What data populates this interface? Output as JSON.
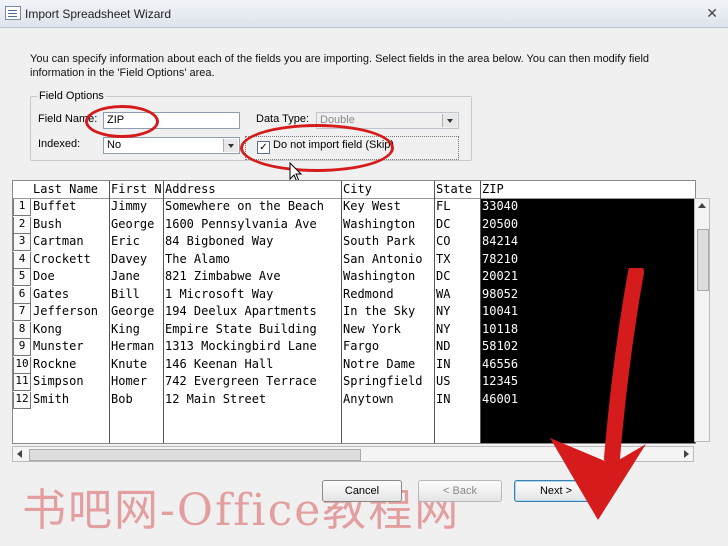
{
  "window": {
    "title": "Import Spreadsheet Wizard",
    "close_glyph": "✕"
  },
  "instructions": "You can specify information about each of the fields you are importing. Select fields in the area below. You can then modify field information in the 'Field Options' area.",
  "field_options": {
    "legend": "Field Options",
    "field_name_label": "Field Name:",
    "field_name_value": "ZIP",
    "data_type_label": "Data Type:",
    "data_type_value": "Double",
    "indexed_label": "Indexed:",
    "indexed_value": "No",
    "skip_label": "Do not import field (Skip)",
    "skip_checked": "✓"
  },
  "grid": {
    "headers": [
      "Last Name",
      "First N",
      "Address",
      "City",
      "State",
      "ZIP"
    ],
    "rows": [
      {
        "n": "1",
        "c": [
          "Buffet",
          "Jimmy",
          "Somewhere on the Beach",
          "Key West",
          "FL",
          "33040"
        ]
      },
      {
        "n": "2",
        "c": [
          "Bush",
          "George",
          "1600 Pennsylvania Ave",
          "Washington",
          "DC",
          "20500"
        ]
      },
      {
        "n": "3",
        "c": [
          "Cartman",
          "Eric",
          "84 Bigboned Way",
          "South Park",
          "CO",
          "84214"
        ]
      },
      {
        "n": "4",
        "c": [
          "Crockett",
          "Davey",
          "The Alamo",
          "San Antonio",
          "TX",
          "78210"
        ]
      },
      {
        "n": "5",
        "c": [
          "Doe",
          "Jane",
          "821 Zimbabwe Ave",
          "Washington",
          "DC",
          "20021"
        ]
      },
      {
        "n": "6",
        "c": [
          "Gates",
          "Bill",
          "1 Microsoft Way",
          "Redmond",
          "WA",
          "98052"
        ]
      },
      {
        "n": "7",
        "c": [
          "Jefferson",
          "George",
          "194 Deelux Apartments",
          "In the Sky",
          "NY",
          "10041"
        ]
      },
      {
        "n": "8",
        "c": [
          "Kong",
          "King",
          "Empire State Building",
          "New York",
          "NY",
          "10118"
        ]
      },
      {
        "n": "9",
        "c": [
          "Munster",
          "Herman",
          "1313 Mockingbird Lane",
          "Fargo",
          "ND",
          "58102"
        ]
      },
      {
        "n": "10",
        "c": [
          "Rockne",
          "Knute",
          "146 Keenan Hall",
          "Notre Dame",
          "IN",
          "46556"
        ]
      },
      {
        "n": "11",
        "c": [
          "Simpson",
          "Homer",
          "742 Evergreen Terrace",
          "Springfield",
          "US",
          "12345"
        ]
      },
      {
        "n": "12",
        "c": [
          "Smith",
          "Bob",
          "12 Main Street",
          "Anytown",
          "IN",
          "46001"
        ]
      }
    ]
  },
  "buttons": {
    "cancel": "Cancel",
    "back": "< Back",
    "next": "Next >"
  },
  "watermark": "书吧网-Office教程网",
  "colors": {
    "annotation_red": "#d51b1b",
    "selected_column_bg": "#000000"
  }
}
